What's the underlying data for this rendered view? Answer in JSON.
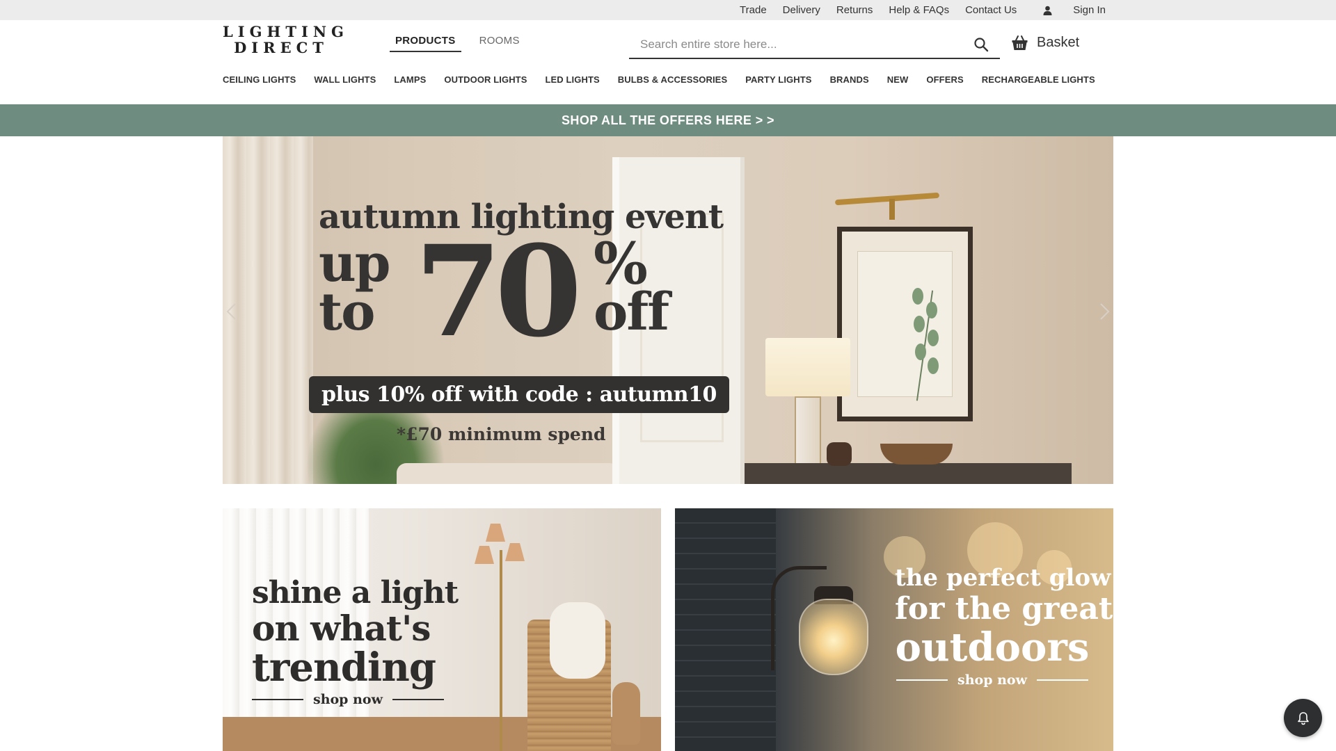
{
  "utility_bar": {
    "links": [
      "Trade",
      "Delivery",
      "Returns",
      "Help & FAQs",
      "Contact Us"
    ],
    "sign_in": "Sign In"
  },
  "header": {
    "logo_line1": "LIGHTING",
    "logo_line2": "DIRECT",
    "mode_tabs": [
      {
        "label": "PRODUCTS",
        "active": true
      },
      {
        "label": "ROOMS",
        "active": false
      }
    ],
    "search": {
      "placeholder": "Search entire store here...",
      "value": ""
    },
    "basket_label": "Basket"
  },
  "main_nav": {
    "items": [
      "CEILING LIGHTS",
      "WALL LIGHTS",
      "LAMPS",
      "OUTDOOR LIGHTS",
      "LED LIGHTS",
      "BULBS & ACCESSORIES",
      "PARTY LIGHTS",
      "BRANDS",
      "NEW",
      "OFFERS",
      "RECHARGEABLE LIGHTS"
    ]
  },
  "offer_strip": {
    "text": "SHOP ALL THE OFFERS HERE > >"
  },
  "hero": {
    "kicker": "autumn lighting event",
    "up": "up",
    "to": "to",
    "number": "70",
    "percent": "%",
    "off": "off",
    "code_text": "plus 10% off with code : autumn10",
    "minimum_text": "*£70 minimum spend"
  },
  "promo_left": {
    "line1": "shine a light",
    "line2": "on what's",
    "line3": "trending",
    "cta": "shop now"
  },
  "promo_right": {
    "line1": "the perfect glow",
    "line2": "for the great",
    "line3": "outdoors",
    "cta": "shop now"
  },
  "colors": {
    "offer_strip_bg": "#6e8c80",
    "utility_bar_bg": "#ececec",
    "text_dark": "#333333"
  },
  "icons": {
    "user": "user-icon",
    "search": "search-icon",
    "basket": "basket-icon",
    "prev": "chevron-left-icon",
    "next": "chevron-right-icon",
    "notification": "bell-icon"
  }
}
